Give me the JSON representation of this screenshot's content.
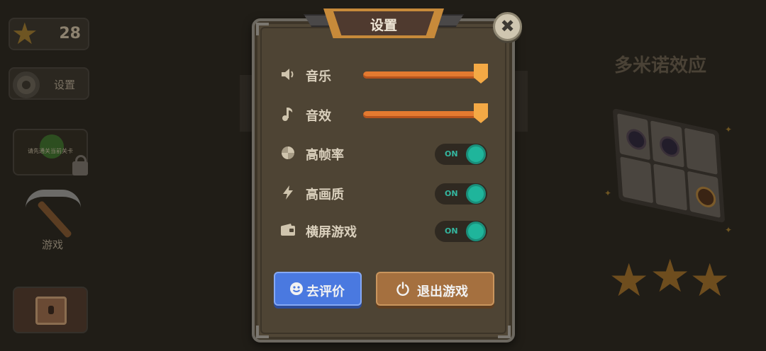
{
  "background": {
    "star_count": "28",
    "settings_label": "设置",
    "locked_level_hint": "请先通关当前关卡",
    "game_label": "游戏",
    "level_title": "多米诺效应",
    "rating_star_count": 3
  },
  "dialog": {
    "title": "设置",
    "close_symbol": "✖",
    "settings": [
      {
        "label": "音乐",
        "icon": "speaker-icon",
        "type": "slider",
        "value": 1.0
      },
      {
        "label": "音效",
        "icon": "music-note-icon",
        "type": "slider",
        "value": 1.0
      },
      {
        "label": "高帧率",
        "icon": "frame-rate-icon",
        "type": "toggle",
        "state": "ON"
      },
      {
        "label": "高画质",
        "icon": "lightning-icon",
        "type": "toggle",
        "state": "ON"
      },
      {
        "label": "横屏游戏",
        "icon": "landscape-icon",
        "type": "toggle",
        "state": "ON"
      }
    ],
    "rate_button": {
      "label": "去评价",
      "icon": "smiley-icon"
    },
    "quit_button": {
      "label": "退出游戏",
      "icon": "power-icon"
    }
  },
  "colors": {
    "slider_fill": "#e37a30",
    "toggle_on": "#1fb59b",
    "rate_button": "#4a79e0",
    "quit_button": "#a5703f"
  }
}
